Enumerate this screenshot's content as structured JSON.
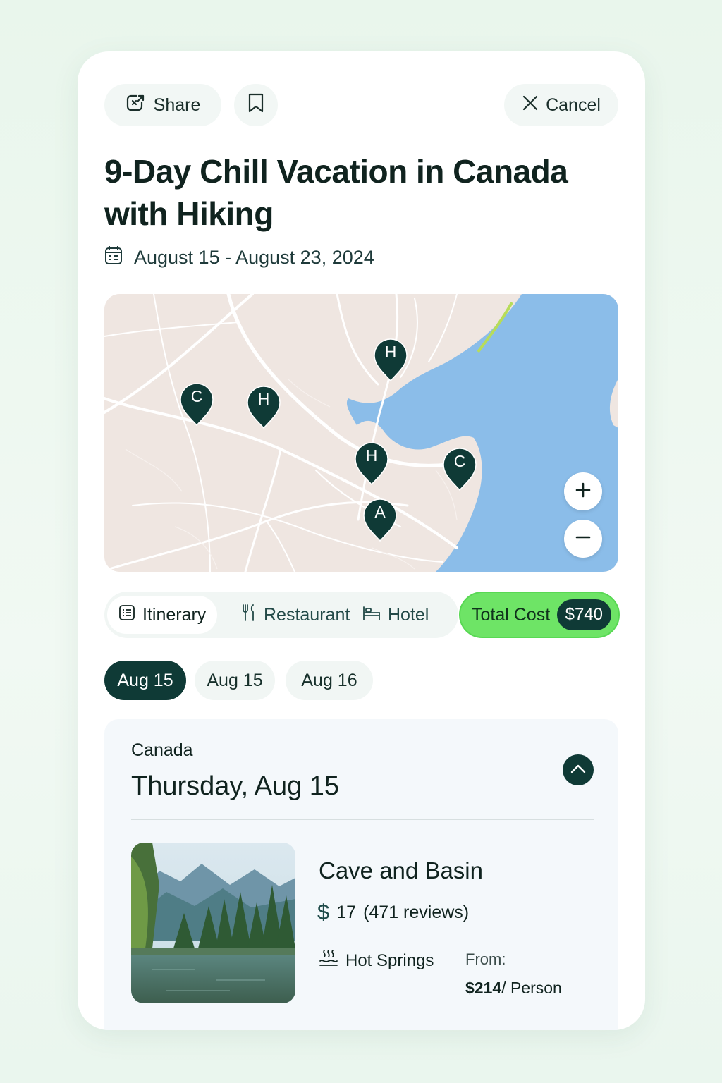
{
  "toolbar": {
    "share_label": "Share",
    "cancel_label": "Cancel"
  },
  "trip": {
    "title": "9-Day Chill Vacation in Canada with Hiking",
    "dates": "August 15 - August 23, 2024"
  },
  "map": {
    "pins": [
      {
        "label": "H",
        "kind": "hotel"
      },
      {
        "label": "C",
        "kind": "camp"
      },
      {
        "label": "H",
        "kind": "hotel"
      },
      {
        "label": "H",
        "kind": "hotel"
      },
      {
        "label": "C",
        "kind": "camp"
      },
      {
        "label": "A",
        "kind": "attraction"
      }
    ],
    "zoom_in_label": "+",
    "zoom_out_label": "−",
    "colors": {
      "water": "#8bbde9",
      "land": "#efe6e1",
      "pin": "#0f3a36"
    }
  },
  "tabs": [
    {
      "label": "Itinerary",
      "icon": "list-icon",
      "active": true
    },
    {
      "label": "Restaurant",
      "icon": "utensils-icon",
      "active": false
    },
    {
      "label": "Hotel",
      "icon": "bed-icon",
      "active": false
    }
  ],
  "total_cost": {
    "label": "Total Cost",
    "value": "$740",
    "color": "#6ee466"
  },
  "date_chips": [
    {
      "label": "Aug 15",
      "selected": true
    },
    {
      "label": "Aug 15",
      "selected": false
    },
    {
      "label": "Aug 16",
      "selected": false
    }
  ],
  "day": {
    "country": "Canada",
    "title": "Thursday, Aug 15",
    "activity": {
      "name": "Cave and Basin",
      "price_level_symbol": "$",
      "rating": "17",
      "reviews": "(471 reviews)",
      "category": "Hot Springs",
      "from_label": "From:",
      "price": "$214",
      "price_unit": "/ Person"
    }
  },
  "accent_color": "#0f3a36"
}
